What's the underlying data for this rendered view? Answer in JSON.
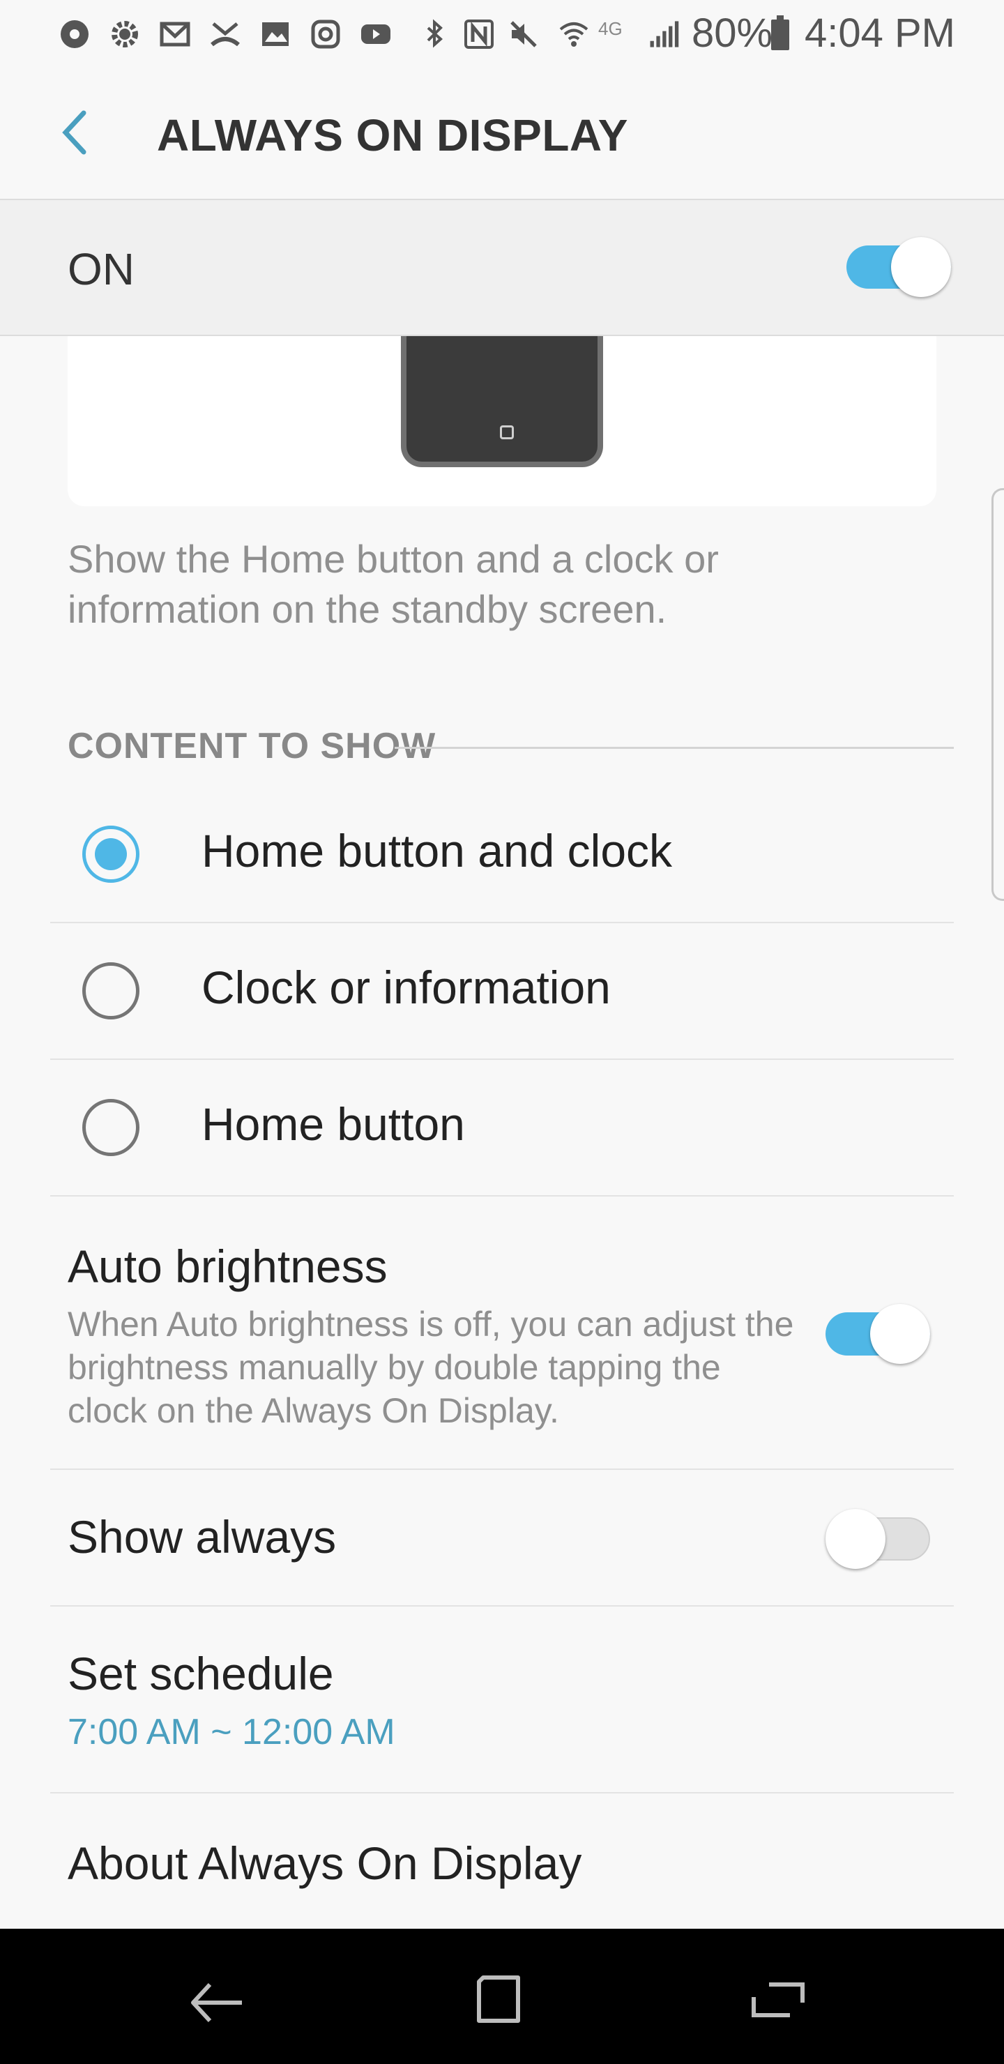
{
  "status_bar": {
    "battery": "80%",
    "time": "4:04 PM",
    "network_label": "4G",
    "icons": [
      "settings-circle-icon",
      "gear-icon",
      "gmail-icon",
      "missed-call-icon",
      "gallery-icon",
      "instagram-icon",
      "youtube-icon",
      "bluetooth-icon",
      "nfc-icon",
      "mute-icon",
      "wifi-icon",
      "signal-icon",
      "battery-icon"
    ]
  },
  "header": {
    "title": "ALWAYS ON DISPLAY"
  },
  "master_switch": {
    "label": "ON",
    "enabled": true
  },
  "description": "Show the Home button and a clock or information on the standby screen.",
  "content_section": {
    "header": "CONTENT TO SHOW",
    "options": [
      {
        "label": "Home button and clock",
        "selected": true
      },
      {
        "label": "Clock or information",
        "selected": false
      },
      {
        "label": "Home button",
        "selected": false
      }
    ]
  },
  "settings": {
    "auto_brightness": {
      "title": "Auto brightness",
      "subtitle": "When Auto brightness is off, you can adjust the brightness manually by double tapping the clock on the Always On Display.",
      "enabled": true
    },
    "show_always": {
      "title": "Show always",
      "enabled": false
    },
    "schedule": {
      "title": "Set schedule",
      "value": "7:00 AM ~ 12:00 AM"
    },
    "about": {
      "title": "About Always On Display"
    }
  },
  "colors": {
    "accent": "#4fb7e6",
    "schedule_text": "#4a9fbf",
    "background": "#f8f8f8"
  }
}
